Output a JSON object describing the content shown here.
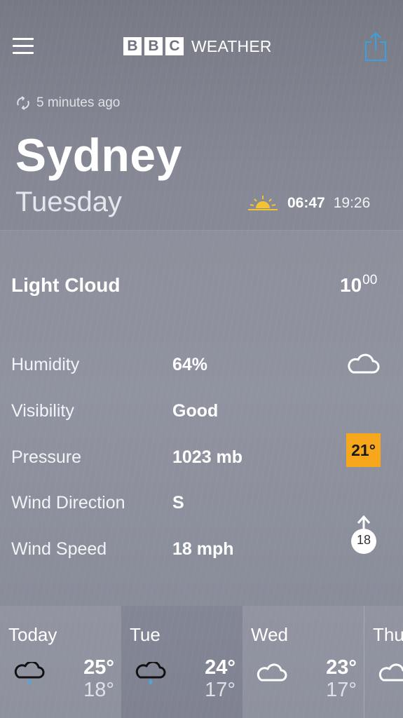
{
  "header": {
    "logo_letters": [
      "B",
      "B",
      "C"
    ],
    "logo_word": "WEATHER",
    "menu_icon": "hamburger-icon",
    "share_icon": "share-icon"
  },
  "location": {
    "updated": "5 minutes ago",
    "city": "Sydney",
    "day": "Tuesday",
    "sunrise": "06:47",
    "sunset": "19:26"
  },
  "current": {
    "condition": "Light Cloud",
    "time_hour": "10",
    "time_min": "00",
    "temperature": "21°",
    "wind_speed_badge": "18",
    "details": [
      {
        "label": "Humidity",
        "value": "64%"
      },
      {
        "label": "Visibility",
        "value": "Good"
      },
      {
        "label": "Pressure",
        "value": "1023 mb"
      },
      {
        "label": "Wind Direction",
        "value": "S"
      },
      {
        "label": "Wind Speed",
        "value": "18 mph"
      }
    ]
  },
  "forecast": [
    {
      "day": "Today",
      "max": "25°",
      "min": "18°",
      "icon": "light-rain-icon"
    },
    {
      "day": "Tue",
      "max": "24°",
      "min": "17°",
      "icon": "light-rain-icon"
    },
    {
      "day": "Wed",
      "max": "23°",
      "min": "17°",
      "icon": "cloud-icon"
    },
    {
      "day": "Thu",
      "icon": "cloud-icon"
    }
  ],
  "colors": {
    "temp_badge": "#f6a71b",
    "sun_icon": "#f4c430",
    "share_icon": "#3aa0e0",
    "rain_drop": "#4aa8e8"
  }
}
